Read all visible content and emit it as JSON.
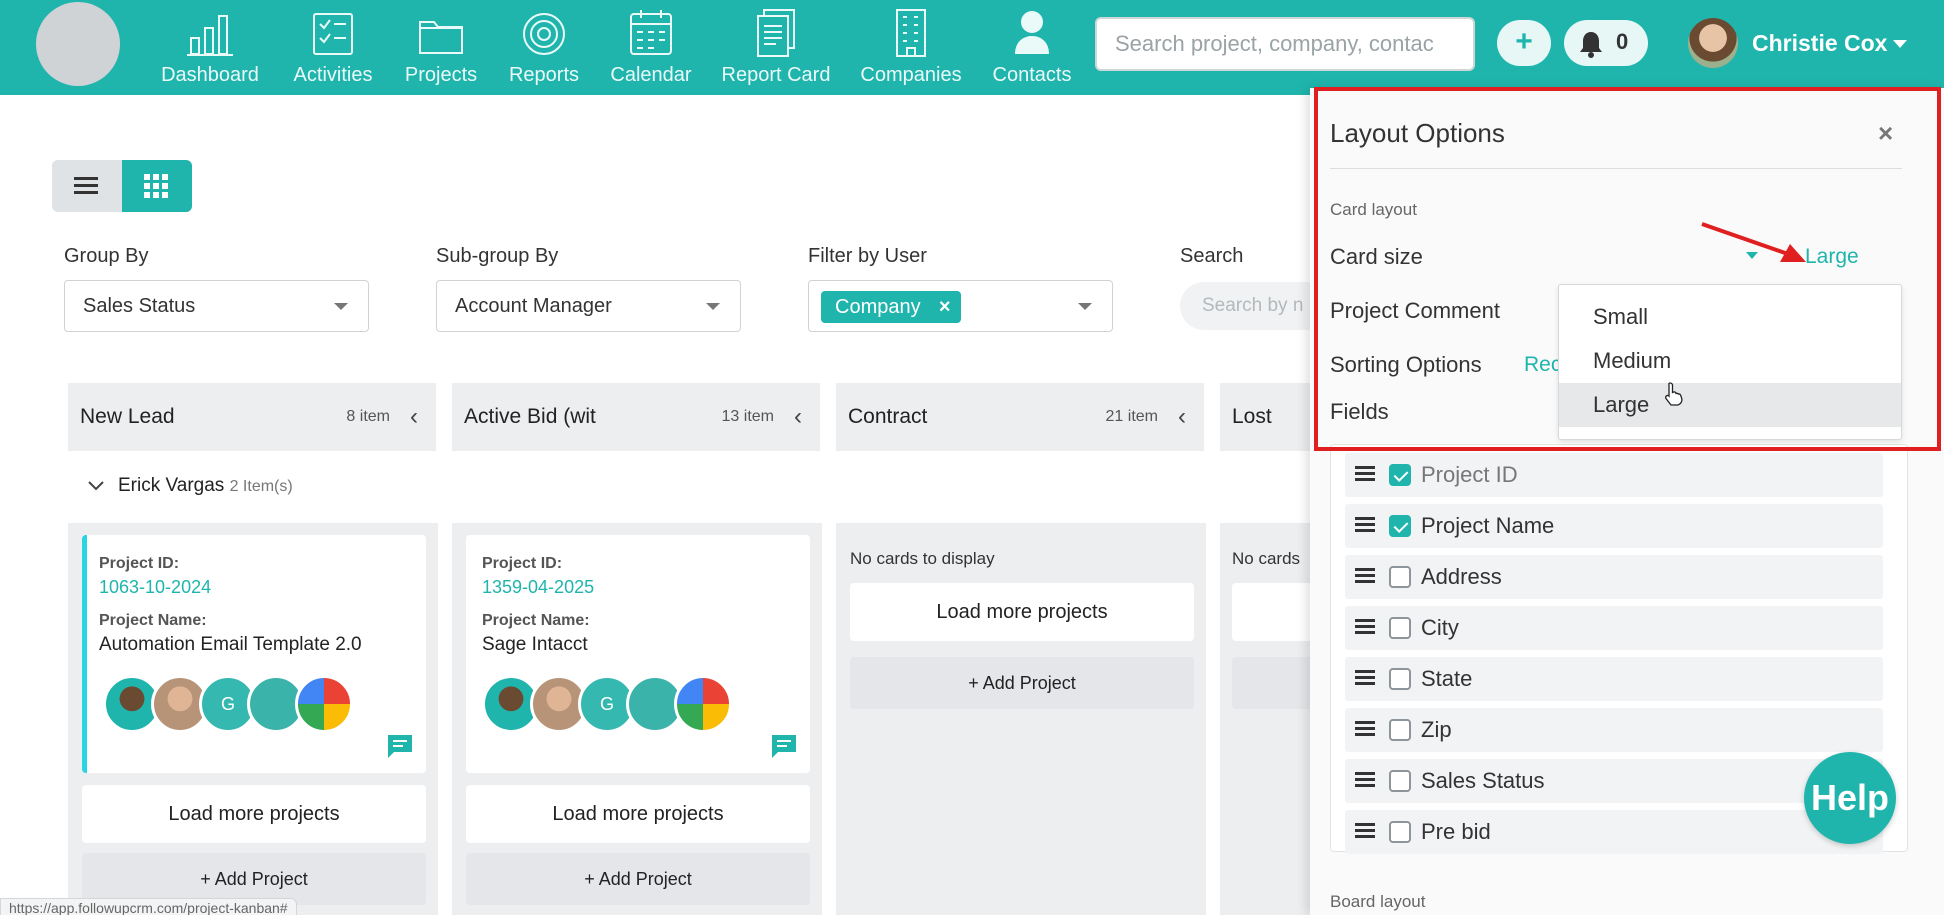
{
  "nav": {
    "items": [
      {
        "label": "Dashboard",
        "icon": "bar-chart-icon"
      },
      {
        "label": "Activities",
        "icon": "checklist-icon"
      },
      {
        "label": "Projects",
        "icon": "folder-icon"
      },
      {
        "label": "Reports",
        "icon": "target-icon"
      },
      {
        "label": "Calendar",
        "icon": "calendar-icon"
      },
      {
        "label": "Report Card",
        "icon": "document-icon"
      },
      {
        "label": "Companies",
        "icon": "building-icon"
      },
      {
        "label": "Contacts",
        "icon": "person-icon"
      }
    ],
    "search_placeholder": "Search project, company, contac",
    "add_label": "+",
    "notifications_count": "0",
    "user_name": "Christie Cox"
  },
  "filters": {
    "group_by_label": "Group By",
    "group_by_value": "Sales Status",
    "subgroup_label": "Sub-group By",
    "subgroup_value": "Account Manager",
    "user_filter_label": "Filter by User",
    "user_filter_chip": "Company",
    "search_label": "Search",
    "search_placeholder": "Search by n"
  },
  "columns": [
    {
      "title": "New Lead",
      "count": "8 item"
    },
    {
      "title": "Active Bid (wit",
      "count": "13 item"
    },
    {
      "title": "Contract",
      "count": "21 item"
    },
    {
      "title": "Lost",
      "count": ""
    }
  ],
  "group": {
    "name": "Erick Vargas",
    "count": "2 Item(s)"
  },
  "cards": [
    {
      "id_label": "Project ID:",
      "id": "1063-10-2024",
      "name_label": "Project Name:",
      "name": "Automation Email Template 2.0",
      "initial": "G"
    },
    {
      "id_label": "Project ID:",
      "id": "1359-04-2025",
      "name_label": "Project Name:",
      "name": "Sage Intacct",
      "initial": "G"
    }
  ],
  "board": {
    "load_more": "Load more projects",
    "add_project": "+ Add Project",
    "no_cards": "No cards to display",
    "no_cards_partial": "No cards"
  },
  "status_url": "https://app.followupcrm.com/project-kanban#",
  "panel": {
    "title": "Layout Options",
    "close": "×",
    "card_layout_label": "Card layout",
    "card_size_label": "Card size",
    "card_size_value": "Large",
    "project_comment_label": "Project Comment",
    "sorting_label": "Sorting Options",
    "sorting_link": "Rec",
    "fields_label": "Fields",
    "board_layout_label": "Board layout",
    "fields": [
      {
        "label": "Project ID",
        "checked": true
      },
      {
        "label": "Project Name",
        "checked": true
      },
      {
        "label": "Address",
        "checked": false
      },
      {
        "label": "City",
        "checked": false
      },
      {
        "label": "State",
        "checked": false
      },
      {
        "label": "Zip",
        "checked": false
      },
      {
        "label": "Sales Status",
        "checked": false
      },
      {
        "label": "Pre bid",
        "checked": false
      }
    ],
    "size_options": [
      "Small",
      "Medium",
      "Large"
    ],
    "size_selected": "Large"
  },
  "help_label": "Help",
  "colors": {
    "accent": "#1fb5ad",
    "highlight": "#e02020"
  }
}
